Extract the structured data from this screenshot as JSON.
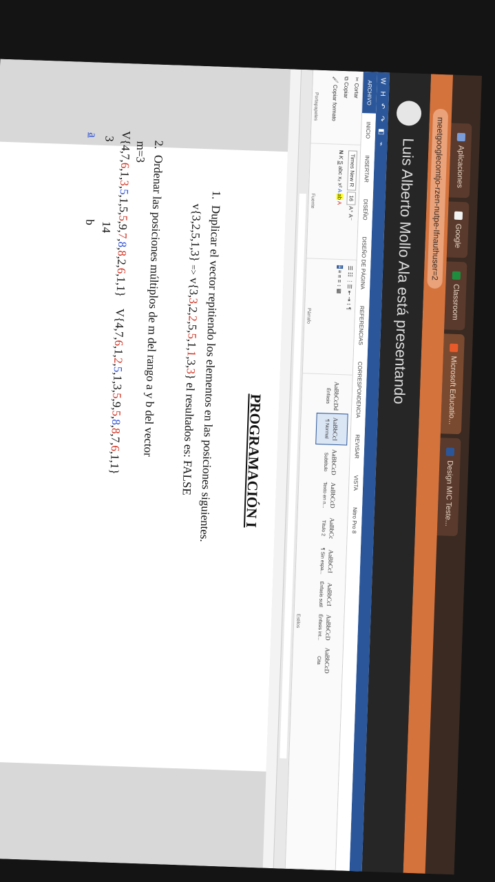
{
  "browser": {
    "tabs": [
      {
        "label": "Aplicaciones",
        "color": "#7a9cd8"
      },
      {
        "label": "Google",
        "color": "#f2f2f2"
      },
      {
        "label": "Classroom",
        "color": "#1e8e3e"
      },
      {
        "label": "Microsoft Educatio...",
        "color": "#e85a2a"
      },
      {
        "label": "Design MIC Teste...",
        "color": "#2b579a"
      }
    ],
    "url": "meetgooglecomtjo-rzen-nutpe-Ifnauthuser=2"
  },
  "presenter": {
    "text": "Luis Alberto Mollo Ala está presentando"
  },
  "word": {
    "qat": [
      "W",
      "H",
      "↶",
      "↷",
      "◧",
      "⌁"
    ],
    "ribbon_tabs": [
      "ARCHIVO",
      "INICIO",
      "INSERTAR",
      "DISEÑO",
      "DISEÑO DE PÁGINA",
      "REFERENCIAS",
      "CORRESPONDENCIA",
      "REVISAR",
      "VISTA",
      "Nitro Pro 8"
    ],
    "clipboard": {
      "cut": "Cortar",
      "copy": "Copiar",
      "format": "Copiar formato",
      "paste": "Pegar",
      "label": "Portapapeles"
    },
    "font": {
      "name": "Times New R",
      "size": "16",
      "label": "Fuente"
    },
    "paragraph": {
      "label": "Párrafo"
    },
    "styles": [
      {
        "sample": "AaBbCcDd",
        "name": "Énfasis"
      },
      {
        "sample": "AaBbCcI",
        "name": "¶ Normal"
      },
      {
        "sample": "AaBbCcD",
        "name": "Subtítulo"
      },
      {
        "sample": "AaBbCcD",
        "name": "Texto en n..."
      },
      {
        "sample": "AaBbCc",
        "name": "Título 2"
      },
      {
        "sample": "AaBbCcI",
        "name": "¶ Sin espa..."
      },
      {
        "sample": "AaBbCcI",
        "name": "Énfasis sutil"
      },
      {
        "sample": "AaBbCcD",
        "name": "Énfasis int..."
      },
      {
        "sample": "AaBbCcD",
        "name": "Cita"
      }
    ],
    "styles_label": "Estilos"
  },
  "document": {
    "title": "PROGRAMACIÓN I",
    "item1": {
      "num": "1.",
      "text": "Duplicar el vector repitiendo los elementos en las posiciones siguientes.",
      "v_left": "v{3,2,5,1,3}",
      "arrow": "=>",
      "v_right_prefix": "v{",
      "v_right_red": [
        "3",
        "3",
        "2",
        "2",
        "5",
        "5",
        "1",
        "1",
        "3",
        "3"
      ],
      "v_right_suffix": "}",
      "result": "el resultados es: FALSE"
    },
    "item2": {
      "num": "2.",
      "text": "Ordenar las posiciones múltiplos de m del rango a y b del vector",
      "m": "m=3",
      "vec_in": "V{4,7,6,1,3,5,1,5,5,9,7,8,8,2,6,1,1}",
      "vec_out": "V{4,7,6,1,2,5,1,3,5,9,5,8,8,7,6,1,1}",
      "n3": "3",
      "n14": "14",
      "a": "a",
      "b": "b"
    }
  }
}
